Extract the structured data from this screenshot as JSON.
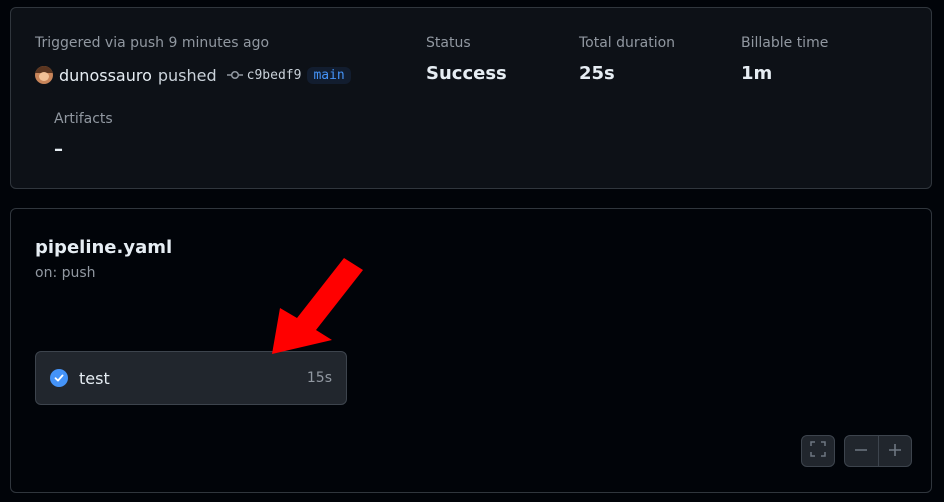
{
  "summary": {
    "trigger_label": "Triggered via push 9 minutes ago",
    "actor": "dunossauro",
    "action": "pushed",
    "commit_sha": "c9bedf9",
    "branch": "main",
    "status_label": "Status",
    "status_value": "Success",
    "duration_label": "Total duration",
    "duration_value": "25s",
    "billable_label": "Billable time",
    "billable_value": "1m",
    "artifacts_label": "Artifacts",
    "artifacts_value": "–"
  },
  "workflow": {
    "file": "pipeline.yaml",
    "trigger": "on: push",
    "jobs": [
      {
        "name": "test",
        "duration": "15s",
        "status": "success",
        "icon": "check-circle-icon"
      }
    ]
  },
  "controls": {
    "fullscreen_icon": "fullscreen-icon",
    "zoom_out_icon": "zoom-out-icon",
    "zoom_in_icon": "zoom-in-icon"
  },
  "annotation": {
    "arrow_color": "#ff0000"
  },
  "colors": {
    "accent": "#4493f8",
    "background": "#010409",
    "card": "#0d1117",
    "border": "#30363d"
  }
}
